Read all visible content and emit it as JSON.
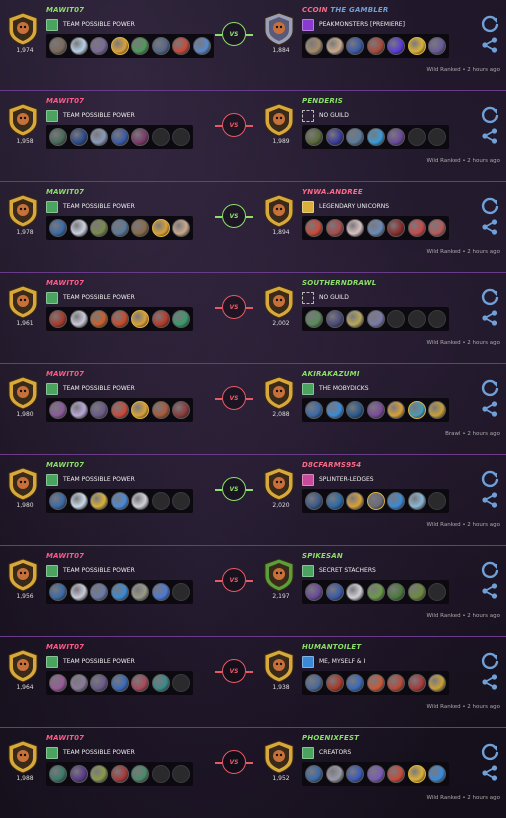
{
  "colors": {
    "background": "#171120",
    "row_divider": "#6a3b8a",
    "name_default": "#8ce06a",
    "name_pink": "#ff5a8a",
    "win": "#8ce06a",
    "loss": "#e85a63",
    "accent_blue": "#6fa0d8"
  },
  "icons": {
    "replay": "replay-icon",
    "share": "share-icon",
    "guild": "guild-crest-icon",
    "no_guild": "dashed-square-icon"
  },
  "battles": [
    {
      "result": "win",
      "vs_label": "VS",
      "meta": "Wild Ranked • 2 hours ago",
      "left": {
        "name": "MAWIT07",
        "name_color": "#8ce06a",
        "rating": "1,974",
        "guild": "TEAM POSSIBLE POWER",
        "guild_color": "#4aa35f",
        "emblem": "gold",
        "cards": [
          "#7a6a5c",
          "#b5cfe6",
          "#7a6a9a",
          "#d8a03a",
          "#4e9a58",
          "#556688",
          "#c84a3a",
          "#5a88c8"
        ],
        "gold": [
          3
        ]
      },
      "right": {
        "name": "CCOIN",
        "name_suffix": "THE GAMBLER",
        "name_color": "#ff6a8a",
        "suffix_color": "#6fa0d8",
        "rating": "1,884",
        "guild": "PEAKMONSTERS [PREMIERE]",
        "guild_color": "#8a3ad0",
        "emblem": "silver",
        "cards": [
          "#a58a6a",
          "#c9a98a",
          "#3a5aa8",
          "#a84a3a",
          "#5a3ad8",
          "#d8b03a",
          "#6a5a9a"
        ],
        "gold": [
          5
        ]
      }
    },
    {
      "result": "loss",
      "vs_label": "VS",
      "meta": "Wild Ranked • 2 hours ago",
      "left": {
        "name": "MAWIT07",
        "name_color": "#ff5a8a",
        "rating": "1,958",
        "guild": "TEAM POSSIBLE POWER",
        "guild_color": "#4aa35f",
        "emblem": "gold",
        "cards": [
          "#4a6a5a",
          "#2a4a8a",
          "#8a9aba",
          "#3a5aa8",
          "#7a3a6a",
          "#2b2b2d",
          "#2b2b2d"
        ],
        "empty": [
          5,
          6
        ]
      },
      "right": {
        "name": "PENDERIS",
        "name_color": "#8ce06a",
        "rating": "1,989",
        "guild": "NO GUILD",
        "guild_color": "none",
        "emblem": "gold",
        "cards": [
          "#5a6a3a",
          "#3a3a9a",
          "#5a7a9a",
          "#3a9ad8",
          "#6a4a9a",
          "#2b2b2d",
          "#2b2b2d"
        ],
        "empty": [
          5,
          6
        ]
      }
    },
    {
      "result": "win",
      "vs_label": "VS",
      "meta": "Wild Ranked • 2 hours ago",
      "left": {
        "name": "MAWIT07",
        "name_color": "#8ce06a",
        "rating": "1,978",
        "guild": "TEAM POSSIBLE POWER",
        "guild_color": "#4aa35f",
        "emblem": "gold",
        "cards": [
          "#3a6aa8",
          "#c9d0e0",
          "#7a8a4a",
          "#5a7a9a",
          "#8a6a4a",
          "#d8a03a",
          "#c9a98a"
        ],
        "gold": [
          5
        ]
      },
      "right": {
        "name": "YNWA.ANDREE",
        "name_color": "#ff6a8a",
        "rating": "1,894",
        "guild": "LEGENDARY UNICORNS",
        "guild_color": "#d8b03a",
        "emblem": "gold",
        "cards": [
          "#c84a3a",
          "#a84a4a",
          "#d8c0c0",
          "#6a8ab8",
          "#8a2a2a",
          "#c84a4a",
          "#b85a5a"
        ]
      }
    },
    {
      "result": "loss",
      "vs_label": "VS",
      "meta": "Wild Ranked • 2 hours ago",
      "left": {
        "name": "MAWIT07",
        "name_color": "#ff5a8a",
        "rating": "1,961",
        "guild": "TEAM POSSIBLE POWER",
        "guild_color": "#4aa35f",
        "emblem": "gold",
        "cards": [
          "#a83a2a",
          "#c9c9d9",
          "#c8602a",
          "#c84a2a",
          "#d8a03a",
          "#b83a2a",
          "#3a9a6a"
        ],
        "gold": [
          4
        ]
      },
      "right": {
        "name": "SOUTHERNDRAWL",
        "name_color": "#8ce06a",
        "rating": "2,002",
        "guild": "NO GUILD",
        "guild_color": "none",
        "emblem": "gold",
        "cards": [
          "#5a8a5a",
          "#4a4a7a",
          "#b8a85a",
          "#7a7aa8",
          "#2b2b2d",
          "#2b2b2d",
          "#2b2b2d"
        ],
        "empty": [
          4,
          5,
          6
        ]
      }
    },
    {
      "result": "loss",
      "vs_label": "VS",
      "meta": "Brawl • 2 hours ago",
      "left": {
        "name": "MAWIT07",
        "name_color": "#ff5a8a",
        "rating": "1,980",
        "guild": "TEAM POSSIBLE POWER",
        "guild_color": "#4aa35f",
        "emblem": "gold",
        "cards": [
          "#8a5a9a",
          "#b8a8d8",
          "#6a5a8a",
          "#c84a3a",
          "#d8a03a",
          "#a85a3a",
          "#8a3a3a"
        ],
        "gold": [
          4
        ]
      },
      "right": {
        "name": "AKIRAKAZUMI",
        "name_color": "#8ce06a",
        "rating": "2,088",
        "guild": "THE MOBYDICKS",
        "guild_color": "#4aa35f",
        "emblem": "gold",
        "cards": [
          "#3a6aa8",
          "#3a8ad8",
          "#2a5a8a",
          "#7a4a9a",
          "#d8a03a",
          "#4a9ab8",
          "#c8a03a"
        ],
        "gold": [
          5
        ]
      }
    },
    {
      "result": "win",
      "vs_label": "VS",
      "meta": "Wild Ranked • 2 hours ago",
      "left": {
        "name": "MAWIT07",
        "name_color": "#8ce06a",
        "rating": "1,980",
        "guild": "TEAM POSSIBLE POWER",
        "guild_color": "#4aa35f",
        "emblem": "gold",
        "cards": [
          "#3a6aa8",
          "#c9d9e9",
          "#d8b03a",
          "#4a8ad8",
          "#d0d0d8",
          "#2b2b2d",
          "#2b2b2d"
        ],
        "empty": [
          5,
          6
        ]
      },
      "right": {
        "name": "D8CFARMS954",
        "name_color": "#ff6a8a",
        "rating": "2,020",
        "guild": "SPLINTER-LEDGES",
        "guild_color": "#c84a9a",
        "emblem": "gold",
        "cards": [
          "#3a5a8a",
          "#2a6aa8",
          "#d8a03a",
          "#6a6a7a",
          "#3a8ad8",
          "#8ab8d8",
          "#2b2b2d"
        ],
        "gold": [
          3
        ],
        "empty": [
          6
        ]
      }
    },
    {
      "result": "loss",
      "vs_label": "VS",
      "meta": "Wild Ranked • 2 hours ago",
      "left": {
        "name": "MAWIT07",
        "name_color": "#ff5a8a",
        "rating": "1,956",
        "guild": "TEAM POSSIBLE POWER",
        "guild_color": "#4aa35f",
        "emblem": "gold",
        "cards": [
          "#3a6aa8",
          "#c9c9d9",
          "#6a7aa8",
          "#3a8ad8",
          "#9a9a8a",
          "#4a7ad8",
          "#2b2b2d"
        ],
        "empty": [
          6
        ]
      },
      "right": {
        "name": "SPIKESAN",
        "name_color": "#8ce06a",
        "rating": "2,197",
        "guild": "SECRET STACHERS",
        "guild_color": "#4aa35f",
        "emblem": "green",
        "cards": [
          "#6a4a9a",
          "#3a5aa8",
          "#d0d0d8",
          "#6a9a4a",
          "#4a7a3a",
          "#6a8a3a",
          "#2b2b2d"
        ],
        "empty": [
          6
        ]
      }
    },
    {
      "result": "loss",
      "vs_label": "VS",
      "meta": "Wild Ranked • 2 hours ago",
      "left": {
        "name": "MAWIT07",
        "name_color": "#ff5a8a",
        "rating": "1,964",
        "guild": "TEAM POSSIBLE POWER",
        "guild_color": "#4aa35f",
        "emblem": "gold",
        "cards": [
          "#9a5a9a",
          "#8a7a9a",
          "#6a5a8a",
          "#3a6ab8",
          "#a84a5a",
          "#3a8a8a",
          "#2b2b2d"
        ],
        "empty": [
          6
        ]
      },
      "right": {
        "name": "HUMANTOILET",
        "name_color": "#8ce06a",
        "rating": "1,938",
        "guild": "ME, MYSELF & I",
        "guild_color": "#3a8ad8",
        "emblem": "gold",
        "cards": [
          "#4a6a9a",
          "#a83a2a",
          "#3a6ab8",
          "#c85a3a",
          "#b84a3a",
          "#a83a3a",
          "#c8a03a"
        ]
      }
    },
    {
      "result": "loss",
      "vs_label": "VS",
      "meta": "Wild Ranked • 2 hours ago",
      "left": {
        "name": "MAWIT07",
        "name_color": "#ff5a8a",
        "rating": "1,988",
        "guild": "TEAM POSSIBLE POWER",
        "guild_color": "#4aa35f",
        "emblem": "gold",
        "cards": [
          "#3a7a6a",
          "#5a3a8a",
          "#8a9a4a",
          "#a83a3a",
          "#4a8a6a",
          "#2b2b2d",
          "#2b2b2d"
        ],
        "empty": [
          5,
          6
        ]
      },
      "right": {
        "name": "PHOENIXFEST",
        "name_color": "#8ce06a",
        "rating": "1,952",
        "guild": "CREATORS",
        "guild_color": "#4aa35f",
        "emblem": "gold",
        "cards": [
          "#3a6aa8",
          "#9a9aa8",
          "#3a5ab8",
          "#7a5ab8",
          "#c84a3a",
          "#d8b03a",
          "#3a8ad8"
        ],
        "gold": [
          5
        ]
      }
    }
  ]
}
